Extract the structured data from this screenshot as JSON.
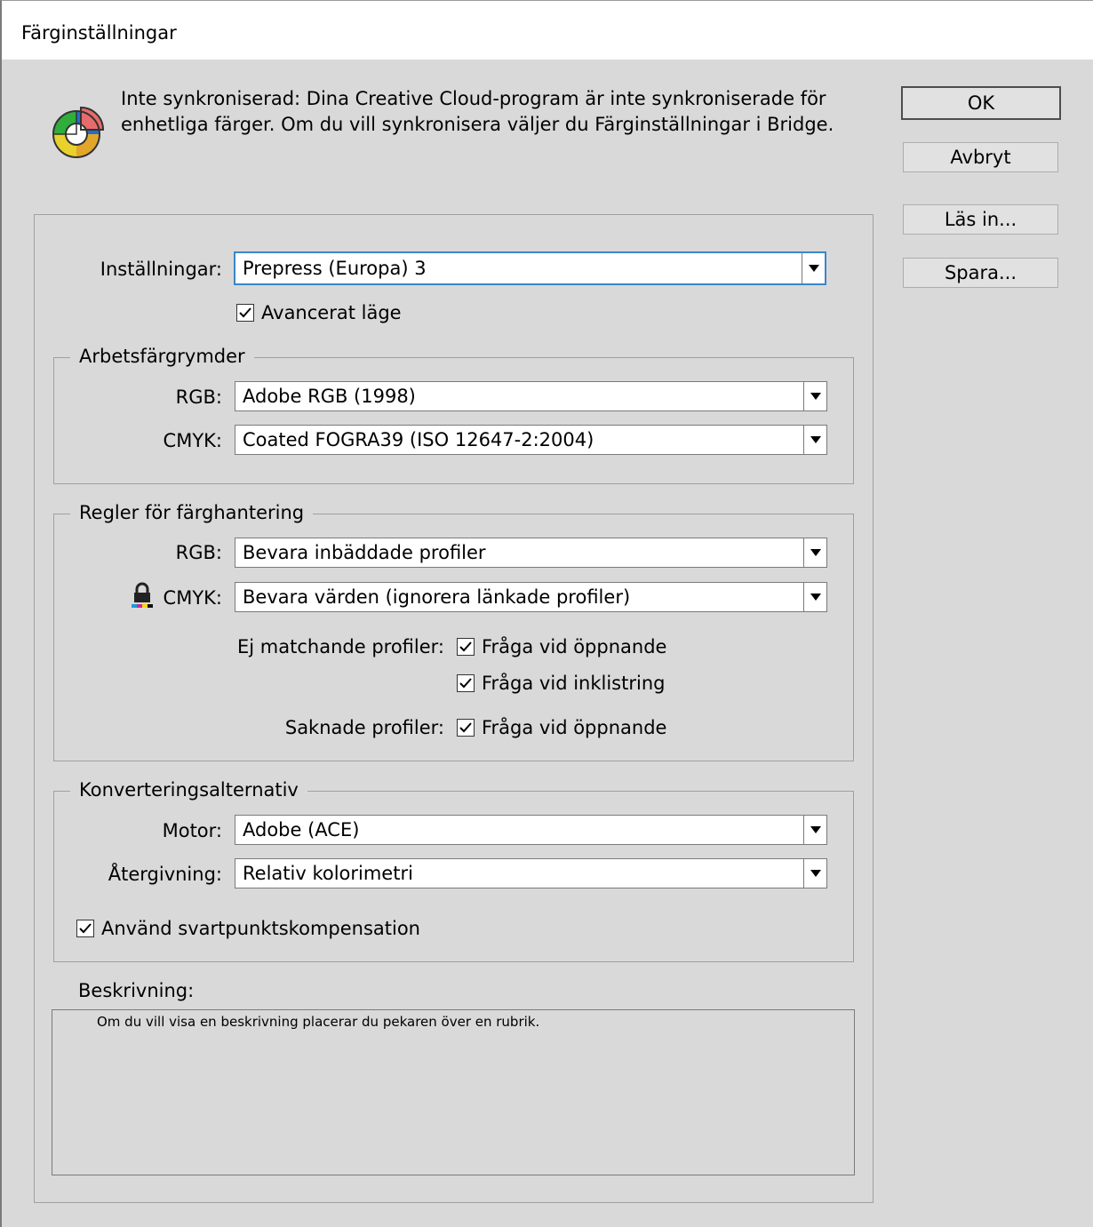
{
  "window": {
    "title": "Färginställningar"
  },
  "sync": {
    "icon": "color-wheel-icon",
    "text_line1": "Inte synkroniserad: Dina Creative Cloud-program är inte synkroniserade för",
    "text_line2": "enhetliga färger. Om du vill synkronisera väljer du Färginställningar i Bridge."
  },
  "buttons": {
    "ok": "OK",
    "cancel": "Avbryt",
    "load": "Läs in...",
    "save": "Spara..."
  },
  "settings": {
    "label": "Inställningar:",
    "value": "Prepress (Europa) 3",
    "advanced_label": "Avancerat läge",
    "advanced_checked": true
  },
  "working_spaces": {
    "legend": "Arbetsfärgrymder",
    "rgb_label": "RGB:",
    "rgb_value": "Adobe RGB (1998)",
    "cmyk_label": "CMYK:",
    "cmyk_value": "Coated FOGRA39 (ISO 12647-2:2004)"
  },
  "policies": {
    "legend": "Regler för färghantering",
    "rgb_label": "RGB:",
    "rgb_value": "Bevara inbäddade profiler",
    "cmyk_label": "CMYK:",
    "cmyk_value": "Bevara värden (ignorera länkade profiler)",
    "cmyk_icon": "lock-icon",
    "mismatch_label": "Ej matchande profiler:",
    "mismatch_open": "Fråga vid öppnande",
    "mismatch_paste": "Fråga vid inklistring",
    "missing_label": "Saknade profiler:",
    "missing_open": "Fråga vid öppnande"
  },
  "conversion": {
    "legend": "Konverteringsalternativ",
    "engine_label": "Motor:",
    "engine_value": "Adobe (ACE)",
    "intent_label": "Återgivning:",
    "intent_value": "Relativ kolorimetri",
    "bpc_label": "Använd svartpunktskompensation"
  },
  "description": {
    "label": "Beskrivning:",
    "text": "Om du vill visa en beskrivning placerar du pekaren över en rubrik."
  },
  "colors": {
    "background": "#d9d9d9",
    "focus": "#3b86c8"
  }
}
